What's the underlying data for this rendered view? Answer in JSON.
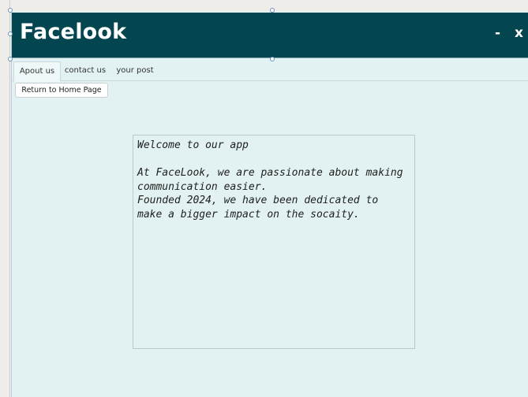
{
  "app": {
    "title": "Facelook",
    "minimize_label": "-",
    "close_label": "x"
  },
  "tabs": [
    {
      "label": "Apout us",
      "active": true
    },
    {
      "label": "contact us",
      "active": false
    },
    {
      "label": "your post",
      "active": false
    }
  ],
  "home_button": {
    "label": "Return to Home Page"
  },
  "content": {
    "heading": "Welcome to our app",
    "body": "At FaceLook, we are passionate about making\ncommunication easier.\nFounded 2024, we have been dedicated to\nmake a bigger impact on the socaity."
  },
  "colors": {
    "titlebar": "#04464f",
    "background": "#e2f2f2"
  }
}
